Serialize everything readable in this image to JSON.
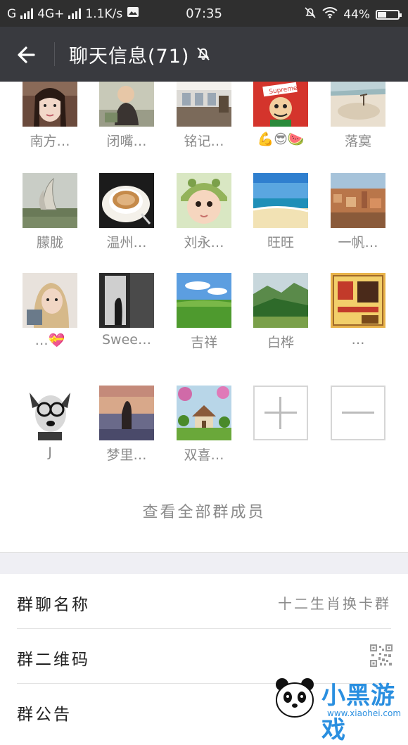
{
  "status_bar": {
    "carrier": "G",
    "network": "4G+",
    "speed": "1.1K/s",
    "time": "07:35",
    "battery": "44%",
    "battery_level": 0.44
  },
  "header": {
    "title": "聊天信息(71)",
    "icons": [
      "back-arrow-icon",
      "mute-bell-icon"
    ]
  },
  "members": [
    {
      "name": "南方…",
      "avatar": "girl-portrait"
    },
    {
      "name": "闭嘴…",
      "avatar": "baby-monk"
    },
    {
      "name": "铭记…",
      "avatar": "office-interior"
    },
    {
      "name": "💪😎🍉",
      "avatar": "supreme-cartoon"
    },
    {
      "name": "落寞",
      "avatar": "beach-sand"
    },
    {
      "name": "朦胧",
      "avatar": "sculpture"
    },
    {
      "name": "温州…",
      "avatar": "coffee-cup"
    },
    {
      "name": "刘永…",
      "avatar": "baby-frog-hat"
    },
    {
      "name": "旺旺",
      "avatar": "sea-beach"
    },
    {
      "name": "一帆…",
      "avatar": "old-town"
    },
    {
      "name": "…💝",
      "avatar": "woman-selfie"
    },
    {
      "name": "Swee…",
      "avatar": "dark-corridor"
    },
    {
      "name": "吉祥",
      "avatar": "green-field"
    },
    {
      "name": "白桦",
      "avatar": "mountain-valley"
    },
    {
      "name": "…",
      "avatar": "chengxin-poster"
    },
    {
      "name": "J",
      "avatar": "schnauzer-dog"
    },
    {
      "name": "梦里…",
      "avatar": "girl-lake-sunset"
    },
    {
      "name": "双喜…",
      "avatar": "garden-cottage"
    }
  ],
  "add_member": {
    "icon": "plus-icon"
  },
  "remove_member": {
    "icon": "minus-icon"
  },
  "view_all": "查看全部群成员",
  "settings": [
    {
      "label": "群聊名称",
      "value": "十二生肖换卡群"
    },
    {
      "label": "群二维码",
      "value": "",
      "icon": "qr-code-icon"
    },
    {
      "label": "群公告",
      "value": ""
    }
  ],
  "watermark": {
    "text": "小黑游戏",
    "url": "www.xiaohei.com"
  },
  "colors": {
    "header_bg": "#393a3f",
    "status_bg": "#2f2f2f",
    "separator": "#efeff4",
    "watermark": "#2a8fe0"
  }
}
